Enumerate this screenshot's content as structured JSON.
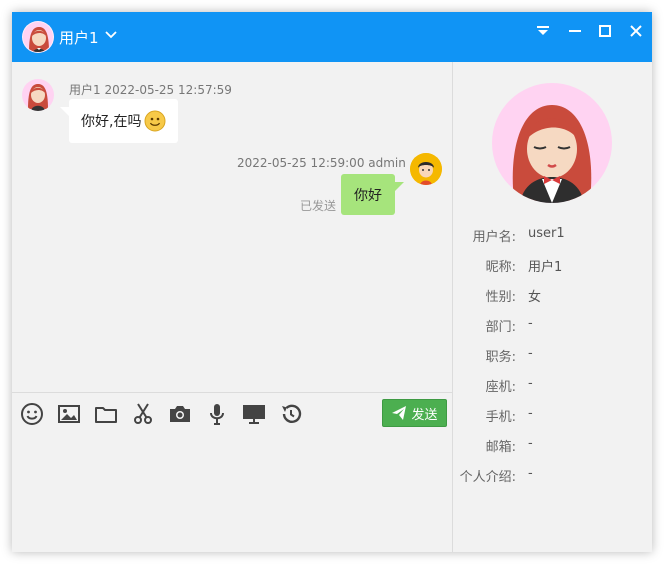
{
  "window": {
    "title_user": "用户1",
    "colors": {
      "titlebar": "#1094f5",
      "bubble_self": "#a6e47c",
      "send_button": "#4caf50"
    }
  },
  "messages": [
    {
      "meta": "用户1 2022-05-25 12:57:59",
      "text": "你好,在吗",
      "side": "left",
      "emoji": "smiley-icon"
    },
    {
      "meta": "2022-05-25 12:59:00 admin",
      "text": "你好",
      "side": "right",
      "status": "已发送"
    }
  ],
  "toolbar": {
    "tools": [
      "emoji-icon",
      "image-icon",
      "folder-icon",
      "scissors-icon",
      "camera-icon",
      "microphone-icon",
      "screen-share-icon",
      "history-icon"
    ],
    "send_label": "发送"
  },
  "profile": {
    "fields": [
      {
        "label": "用户名:",
        "value": "user1"
      },
      {
        "label": "昵称:",
        "value": "用户1"
      },
      {
        "label": "性别:",
        "value": "女"
      },
      {
        "label": "部门:",
        "value": "-"
      },
      {
        "label": "职务:",
        "value": "-"
      },
      {
        "label": "座机:",
        "value": "-"
      },
      {
        "label": "手机:",
        "value": "-"
      },
      {
        "label": "邮箱:",
        "value": "-"
      },
      {
        "label": "个人介绍:",
        "value": "-"
      }
    ]
  }
}
